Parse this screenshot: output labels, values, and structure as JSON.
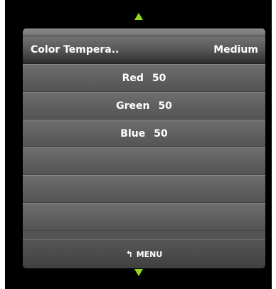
{
  "header": {
    "label": "Color Tempera..",
    "value": "Medium"
  },
  "rows": [
    {
      "label": "Red",
      "value": "50"
    },
    {
      "label": "Green",
      "value": "50"
    },
    {
      "label": "Blue",
      "value": "50"
    },
    {
      "label": "",
      "value": ""
    },
    {
      "label": "",
      "value": ""
    },
    {
      "label": "",
      "value": ""
    }
  ],
  "footer": {
    "icon": "return-arrow-icon",
    "label": "MENU"
  },
  "colors": {
    "arrow": "#8fd81e",
    "panel": "#5f5f5f",
    "background": "#000000"
  }
}
